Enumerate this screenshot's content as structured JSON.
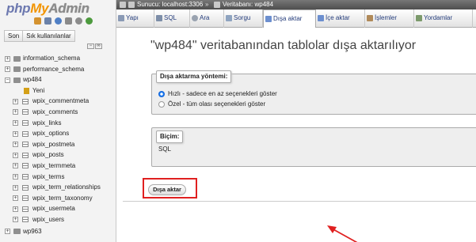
{
  "nav": {
    "logo": {
      "php": "php",
      "my": "My",
      "admin": "Admin"
    },
    "tabs": [
      "Son",
      "Sık kullanılanlar"
    ],
    "tree": [
      {
        "label": "information_schema",
        "type": "db",
        "expanded": false
      },
      {
        "label": "performance_schema",
        "type": "db",
        "expanded": false
      },
      {
        "label": "wp484",
        "type": "db",
        "expanded": true
      },
      {
        "label": "Yeni",
        "type": "new"
      },
      {
        "label": "wpix_commentmeta",
        "type": "table"
      },
      {
        "label": "wpix_comments",
        "type": "table"
      },
      {
        "label": "wpix_links",
        "type": "table"
      },
      {
        "label": "wpix_options",
        "type": "table"
      },
      {
        "label": "wpix_postmeta",
        "type": "table"
      },
      {
        "label": "wpix_posts",
        "type": "table"
      },
      {
        "label": "wpix_termmeta",
        "type": "table"
      },
      {
        "label": "wpix_terms",
        "type": "table"
      },
      {
        "label": "wpix_term_relationships",
        "type": "table"
      },
      {
        "label": "wpix_term_taxonomy",
        "type": "table"
      },
      {
        "label": "wpix_usermeta",
        "type": "table"
      },
      {
        "label": "wpix_users",
        "type": "table"
      },
      {
        "label": "wp963",
        "type": "db",
        "expanded": false
      }
    ]
  },
  "breadcrumb": {
    "server": "Sunucu: localhost:3306",
    "separator": "»",
    "database": "Veritabanı: wp484"
  },
  "tabs": [
    {
      "label": "Yapı",
      "icon": "structure-icon"
    },
    {
      "label": "SQL",
      "icon": "sql-icon"
    },
    {
      "label": "Ara",
      "icon": "search-icon"
    },
    {
      "label": "Sorgu",
      "icon": "query-icon"
    },
    {
      "label": "Dışa aktar",
      "icon": "export-icon",
      "active": true
    },
    {
      "label": "İçe aktar",
      "icon": "import-icon"
    },
    {
      "label": "İşlemler",
      "icon": "operations-icon"
    },
    {
      "label": "Yordamlar",
      "icon": "routines-icon"
    }
  ],
  "main": {
    "title": "\"wp484\" veritabanından tablolar dışa aktarılıyor",
    "export_method": {
      "legend": "Dışa aktarma yöntemi:",
      "options": [
        {
          "label": "Hızlı - sadece en az seçenekleri göster",
          "selected": true
        },
        {
          "label": "Özel - tüm olası seçenekleri göster",
          "selected": false
        }
      ]
    },
    "format": {
      "legend": "Biçim:",
      "selected": "SQL"
    },
    "export_button": "Dışa aktar"
  },
  "colors": {
    "highlight": "#e02020",
    "tab_text": "#233b7a",
    "radio_selected": "#1778f2"
  }
}
